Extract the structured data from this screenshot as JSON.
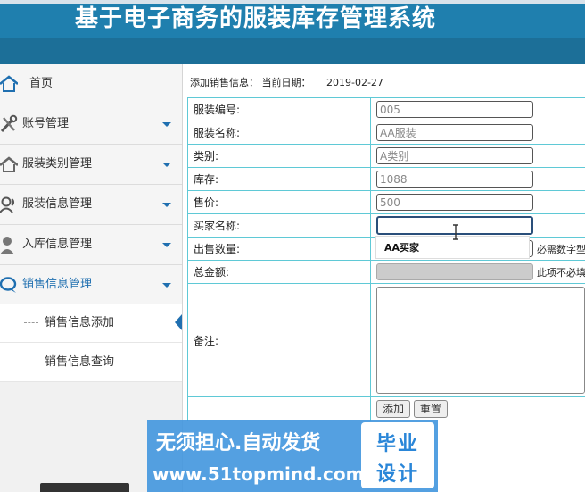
{
  "header": {
    "title": "基于电子商务的服装库存管理系统"
  },
  "sidebar": {
    "items": [
      {
        "label": "首页",
        "icon": "home-icon"
      },
      {
        "label": "账号管理",
        "icon": "tools-icon"
      },
      {
        "label": "服装类别管理",
        "icon": "home-icon"
      },
      {
        "label": "服装信息管理",
        "icon": "users-icon"
      },
      {
        "label": "入库信息管理",
        "icon": "user-icon"
      },
      {
        "label": "销售信息管理",
        "icon": "chat-icon"
      }
    ],
    "subitems": [
      {
        "label": "销售信息添加"
      },
      {
        "label": "销售信息查询"
      }
    ]
  },
  "page": {
    "heading": "添加销售信息：",
    "date_label": "当前日期：",
    "date": "2019-02-27"
  },
  "form": {
    "code_label": "服装编号:",
    "code_value": "005",
    "name_label": "服装名称:",
    "name_value": "AA服装",
    "category_label": "类别:",
    "category_value": "A类别",
    "stock_label": "库存:",
    "stock_value": "1088",
    "price_label": "售价:",
    "price_value": "500",
    "buyer_label": "买家名称:",
    "buyer_value": "",
    "buyer_suggestion": "AA买家",
    "qty_label": "出售数量:",
    "qty_value": "",
    "qty_hint": "必需数字型",
    "total_label": "总金额:",
    "total_value": "",
    "total_hint": "此项不必填",
    "remark_label": "备注:",
    "remark_value": "",
    "add_button": "添加",
    "reset_button": "重置"
  },
  "watermark": {
    "line1": "无须担心.自动发货",
    "line2": "www.51topmind.com",
    "logo_top": "毕业",
    "logo_bottom": "设计"
  },
  "colors": {
    "header": "#1f7fae",
    "accent": "#1f6fb0",
    "border": "#5fc9d6",
    "watermark": "#4196de"
  }
}
